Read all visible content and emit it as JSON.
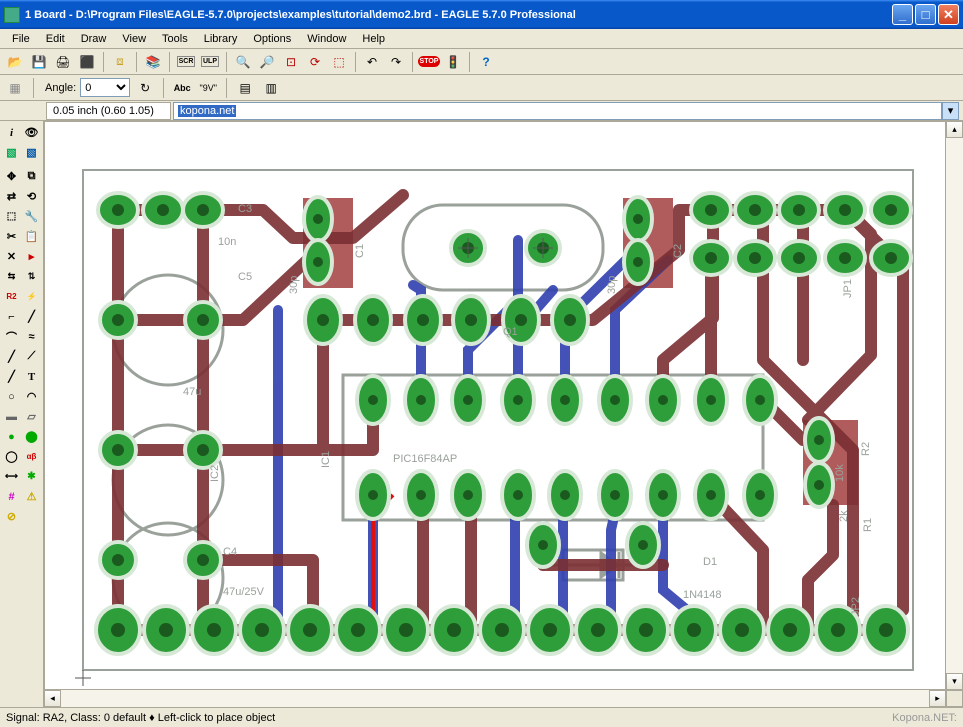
{
  "titlebar": {
    "text": "1 Board - D:\\Program Files\\EAGLE-5.7.0\\projects\\examples\\tutorial\\demo2.brd - EAGLE 5.7.0 Professional"
  },
  "menubar": {
    "items": [
      "File",
      "Edit",
      "Draw",
      "View",
      "Tools",
      "Library",
      "Options",
      "Window",
      "Help"
    ]
  },
  "toolbar2": {
    "angle_label": "Angle:",
    "angle_value": "0"
  },
  "coord_bar": {
    "coords": "0.05 inch (0.60 1.05)",
    "command": "kopona.net"
  },
  "statusbar": {
    "left": "Signal: RA2, Class: 0 default  ♦ Left-click to place object",
    "right": "Kopona.NET:"
  },
  "pcb": {
    "silk_texts": [
      "C3",
      "10n",
      "C5",
      "47u",
      "IC2",
      "C4",
      "47u/25V",
      "C1",
      "30p",
      "30p",
      "C2",
      "IC1",
      "PIC16F84AP",
      "Q1",
      "D1",
      "1N4148",
      "JP1",
      "JP2",
      "R2",
      "10k",
      "R1",
      "2k"
    ],
    "colors": {
      "pad": "#2e9e3a",
      "pad_ring": "#d7e8d7",
      "top_trace": "#7b2f32",
      "bottom_trace": "#3040b0",
      "net_wire": "#d02020",
      "silk": "#9aa19a",
      "outline": "#9aa19a",
      "smd": "#a03838"
    }
  }
}
